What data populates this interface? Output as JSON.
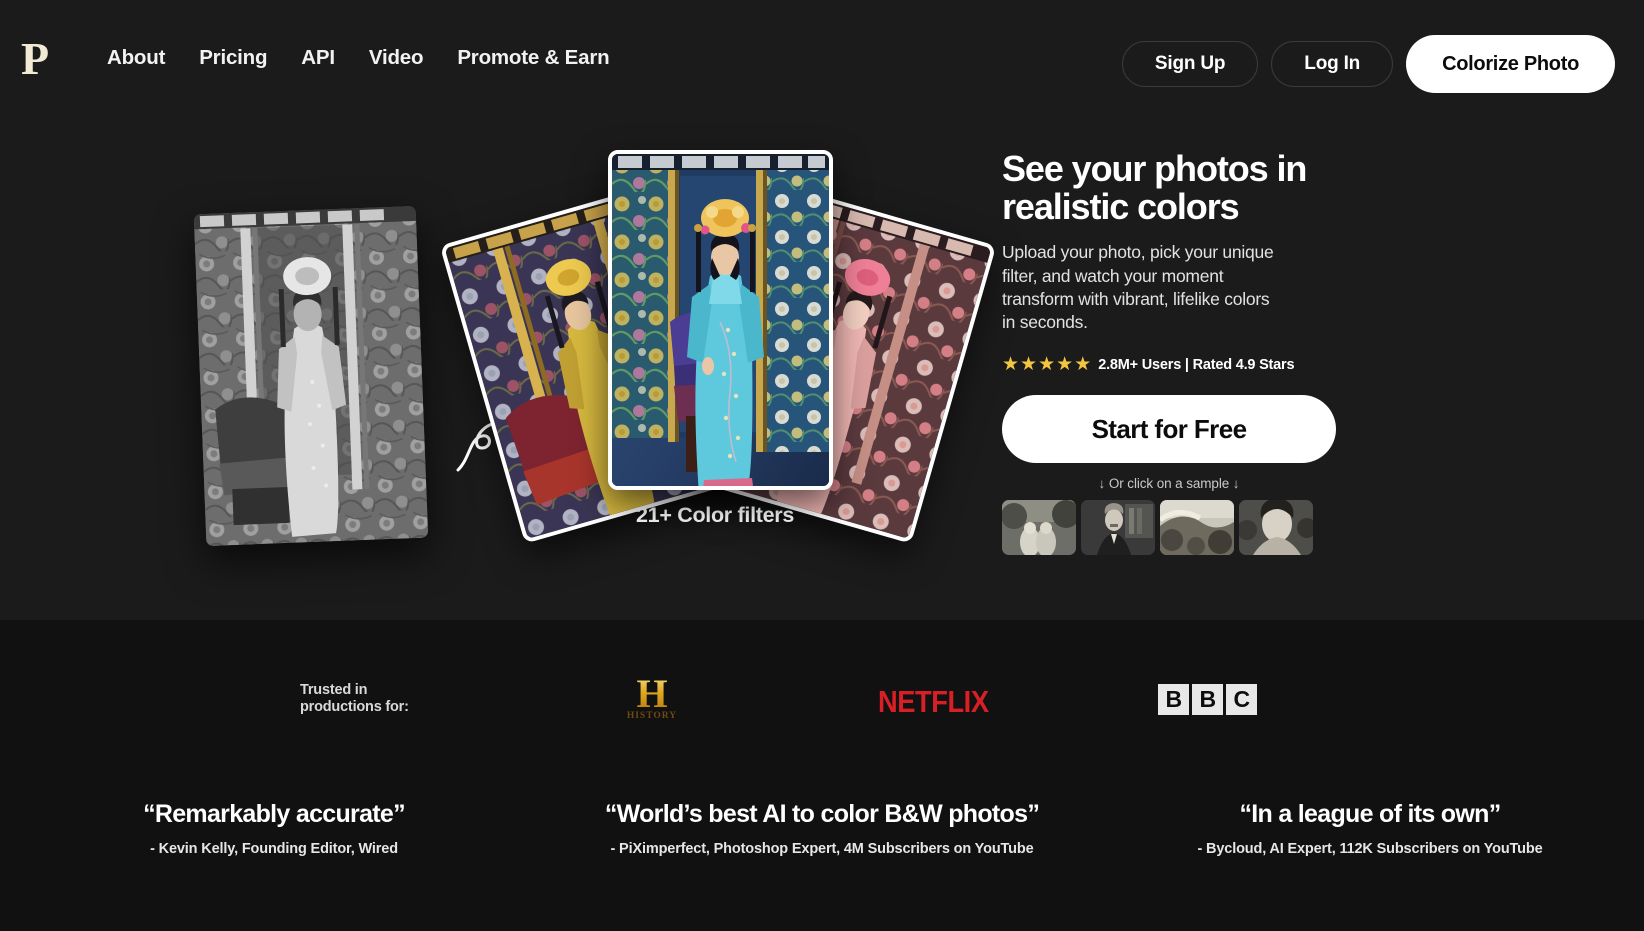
{
  "brand": {
    "logo_letter": "P"
  },
  "nav": {
    "links": [
      {
        "label": "About"
      },
      {
        "label": "Pricing"
      },
      {
        "label": "API"
      },
      {
        "label": "Video"
      },
      {
        "label": "Promote & Earn"
      }
    ],
    "sign_up": "Sign Up",
    "log_in": "Log In",
    "colorize": "Colorize Photo"
  },
  "hero": {
    "headline": "See your photos in\nrealistic colors",
    "subcopy": "Upload your photo, pick your unique\nfilter, and watch your moment\ntransform with vibrant, lifelike colors\nin seconds.",
    "stars": "★★★★★",
    "star_count": 5,
    "rating_text": "2.8M+ Users | Rated 4.9 Stars",
    "cta_label": "Start for Free",
    "sample_hint": "↓ Or click on a sample ↓",
    "filters_label": "21+ Color filters",
    "samples": [
      {
        "name": "sample-couple-garden"
      },
      {
        "name": "sample-man-portrait"
      },
      {
        "name": "sample-landscape"
      },
      {
        "name": "sample-woman-group"
      }
    ]
  },
  "colors": {
    "accent_star": "#f3c541",
    "cta_bg": "#ffffff",
    "page_bg": "#1b1b1b",
    "netflix_red": "#d81f26",
    "history_gold": "#e0a821"
  },
  "trusted": {
    "label": "Trusted in\nproductions for:",
    "logos": [
      {
        "name": "history-logo",
        "mark": "H",
        "word": "HISTORY"
      },
      {
        "name": "netflix-logo",
        "text": "NETFLIX"
      },
      {
        "name": "bbc-logo",
        "letters": [
          "B",
          "B",
          "C"
        ]
      }
    ]
  },
  "testimonials": [
    {
      "quote": "“Remarkably accurate”",
      "author": "- Kevin Kelly, Founding Editor, Wired"
    },
    {
      "quote": "“World’s best AI to color B&W photos”",
      "author": "- PiXimperfect, Photoshop Expert, 4M Subscribers on YouTube"
    },
    {
      "quote": "“In a league of its own”",
      "author": "- Bycloud, AI Expert, 112K Subscribers on YouTube"
    }
  ]
}
